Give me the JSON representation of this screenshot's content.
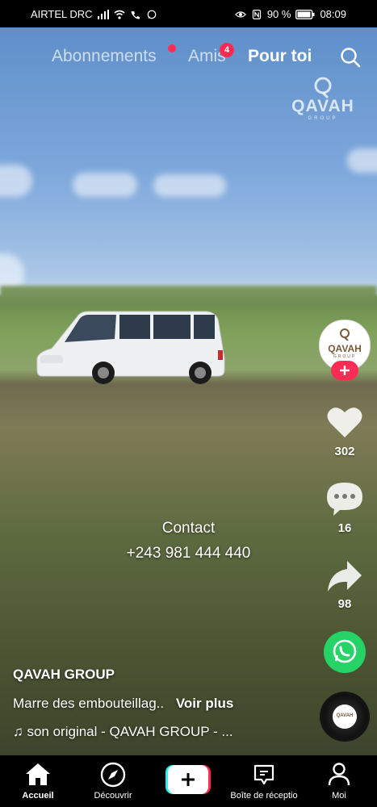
{
  "status_bar": {
    "carrier": "AIRTEL DRC",
    "battery": "90 %",
    "time": "08:09"
  },
  "top_tabs": {
    "following": "Abonnements",
    "friends": "Amis",
    "friends_badge": "4",
    "for_you": "Pour toi"
  },
  "watermark": {
    "brand": "QAVAH",
    "sub": "GROUP"
  },
  "profile": {
    "avatar_brand": "QAVAH",
    "avatar_sub": "GROUP"
  },
  "actions": {
    "likes": "302",
    "comments": "16",
    "shares": "98"
  },
  "video_overlay": {
    "line1": "Contact",
    "line2": "+243 981 444 440"
  },
  "post": {
    "author": "QAVAH GROUP",
    "description": "Marre des embouteillag..",
    "see_more": "Voir plus",
    "sound": "♫ son original - QAVAH GROUP - ..."
  },
  "disc": {
    "brand": "QAVAH"
  },
  "bottom_nav": {
    "home": "Accueil",
    "discover": "Découvrir",
    "inbox": "Boîte de réceptio",
    "profile": "Moi"
  },
  "colors": {
    "accent": "#fe2c55",
    "whatsapp": "#25d366",
    "brand": "#7b5a3c"
  }
}
